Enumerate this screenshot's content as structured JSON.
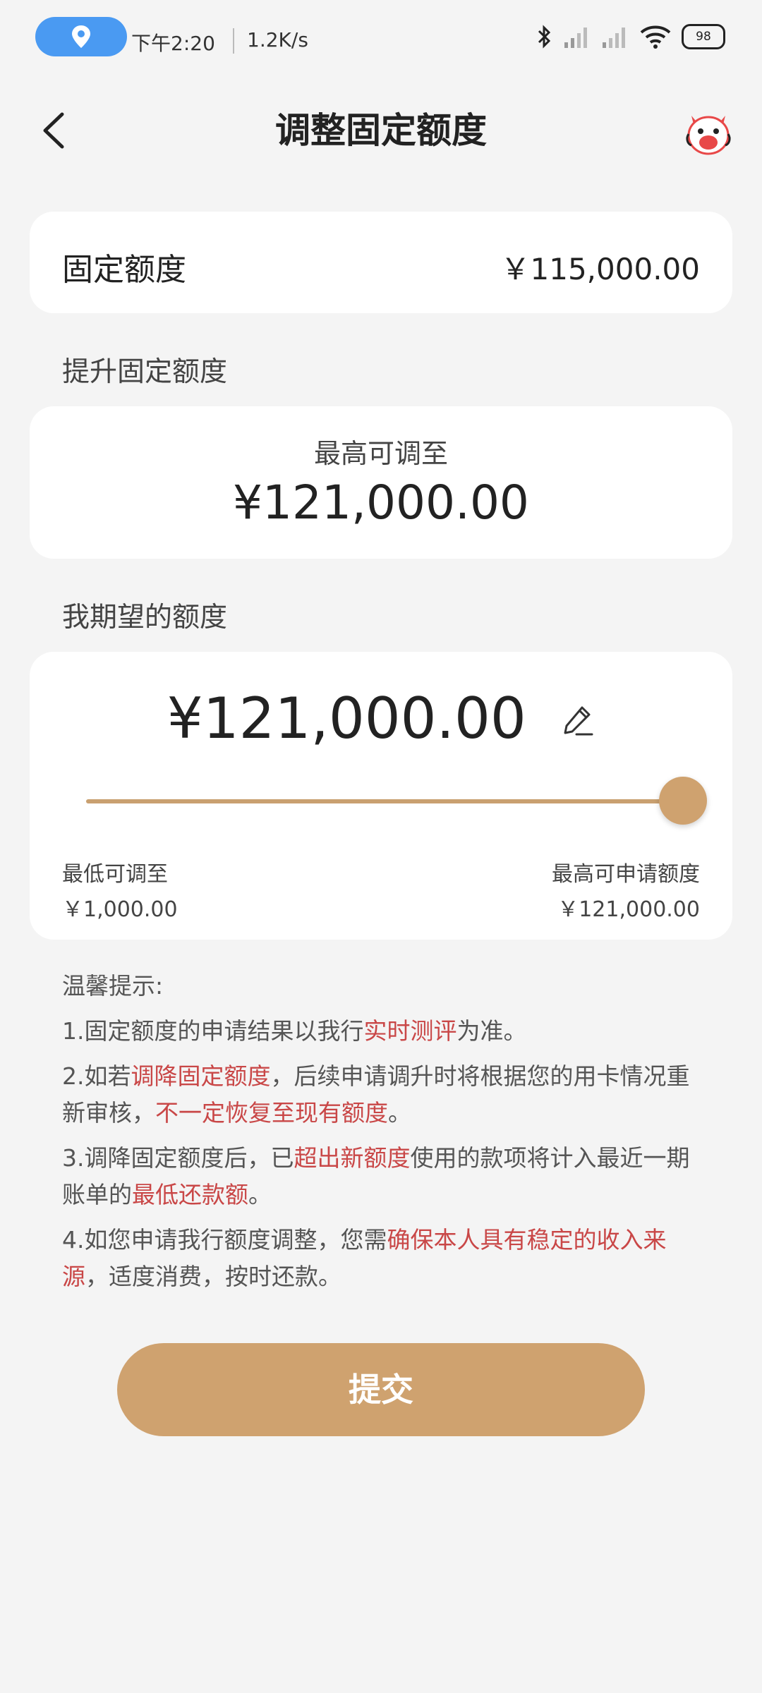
{
  "status_bar": {
    "time": "下午2:20",
    "speed": "1.2K/s",
    "battery": "98"
  },
  "nav": {
    "title": "调整固定额度"
  },
  "fixed_limit": {
    "label": "固定额度",
    "value": "￥115,000.00"
  },
  "raise_section": {
    "title": "提升固定额度",
    "max_label": "最高可调至",
    "max_value": "¥121,000.00"
  },
  "expect_section": {
    "title": "我期望的额度",
    "value": "¥121,000.00",
    "slider_level": 1.0,
    "min_label": "最低可调至",
    "min_value": "￥1,000.00",
    "max_label": "最高可申请额度",
    "max_value": "￥121,000.00"
  },
  "tips": {
    "title": "温馨提示:",
    "t1_a": "1.固定额度的申请结果以我行",
    "t1_b": "实时测评",
    "t1_c": "为准。",
    "t2_a": "2.如若",
    "t2_b": "调降固定额度",
    "t2_c": "，后续申请调升时将根据您的用卡情况重新审核，",
    "t2_d": "不一定恢复至现有额度",
    "t2_e": "。",
    "t3_a": "3.调降固定额度后，已",
    "t3_b": "超出新额度",
    "t3_c": "使用的款项将计入最近一期账单的",
    "t3_d": "最低还款额",
    "t3_e": "。",
    "t4_a": "4.如您申请我行额度调整，您需",
    "t4_b": "确保本人具有稳定的收入来源",
    "t4_c": "，适度消费，按时还款。"
  },
  "submit_label": "提交",
  "colors": {
    "accent": "#cfa26f",
    "highlight": "#c94747",
    "background": "#f4f4f4"
  },
  "icons": [
    "location-icon",
    "bluetooth-icon",
    "signal-icon",
    "wifi-icon",
    "battery-icon",
    "back-icon",
    "mascot-icon",
    "edit-icon"
  ]
}
